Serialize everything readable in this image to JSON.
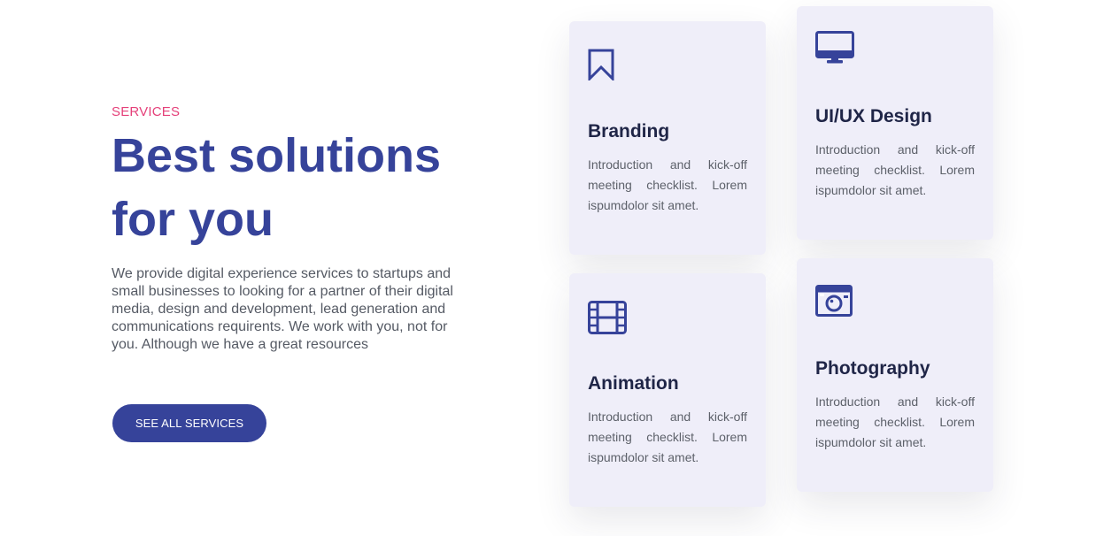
{
  "section": {
    "eyebrow": "SERVICES",
    "headline": "Best solutions for you",
    "description": "We provide digital experience services to startups and small businesses to looking for a partner of their digital media, design and development, lead generation and communications requirents. We work with you, not for you. Although we have a great resources",
    "cta_label": "SEE ALL SERVICES"
  },
  "services": [
    {
      "icon": "bookmark-icon",
      "title": "Branding",
      "text": "Introduction and kick-off meeting checklist. Lorem ispumdolor sit amet."
    },
    {
      "icon": "monitor-icon",
      "title": "UI/UX Design",
      "text": "Introduction and kick-off meeting checklist. Lorem ispumdolor sit amet."
    },
    {
      "icon": "film-icon",
      "title": "Animation",
      "text": "Introduction and kick-off meeting checklist. Lorem ispumdolor sit amet."
    },
    {
      "icon": "camera-icon",
      "title": "Photography",
      "text": "Introduction and kick-off meeting checklist. Lorem ispumdolor sit amet."
    }
  ],
  "colors": {
    "accent": "#36439a",
    "eyebrow": "#e5417a",
    "card_background": "#efeef9",
    "card_title": "#1f2547",
    "body_text": "#555a64"
  }
}
